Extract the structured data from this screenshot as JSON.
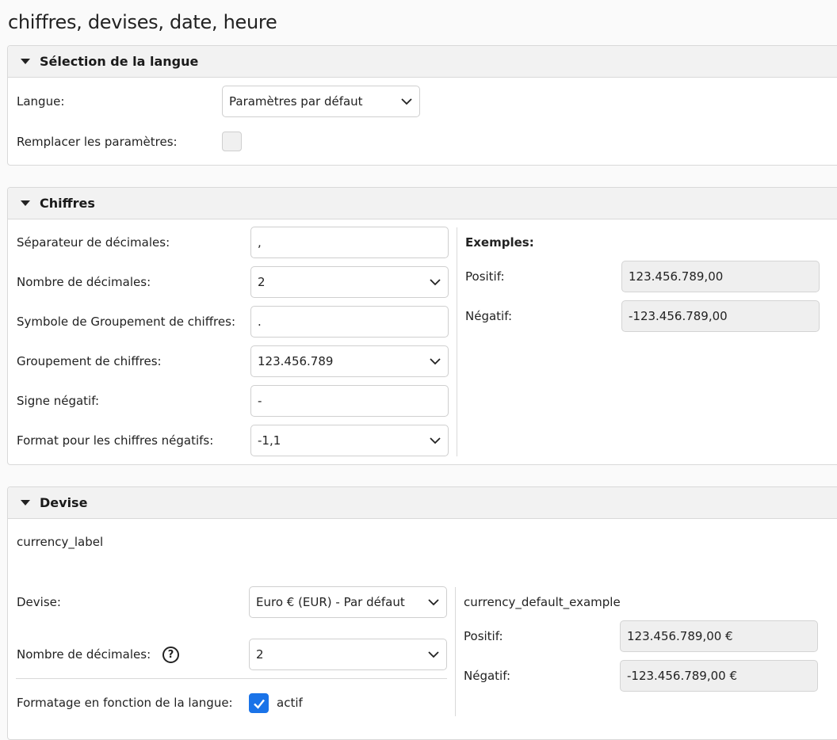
{
  "page": {
    "title": "chiffres, devises, date, heure"
  },
  "language_section": {
    "title": "Sélection de la langue",
    "language_label": "Langue:",
    "language_value": "Paramètres par défaut",
    "override_label": "Remplacer les paramètres:",
    "override_checked": false
  },
  "numbers_section": {
    "title": "Chiffres",
    "decimal_separator_label": "Séparateur de décimales:",
    "decimal_separator_value": ",",
    "decimals_label": "Nombre de décimales:",
    "decimals_value": "2",
    "grouping_symbol_label": "Symbole de Groupement de chiffres:",
    "grouping_symbol_value": ".",
    "grouping_label": "Groupement de chiffres:",
    "grouping_value": "123.456.789",
    "negative_sign_label": "Signe négatif:",
    "negative_sign_value": "-",
    "negative_format_label": "Format pour les chiffres négatifs:",
    "negative_format_value": "-1,1",
    "examples_title": "Exemples:",
    "positive_label": "Positif:",
    "positive_value": "123.456.789,00",
    "negative_label": "Négatif:",
    "negative_value": "-123.456.789,00"
  },
  "currency_section": {
    "title": "Devise",
    "currency_label_text": "currency_label",
    "currency_field_label": "Devise:",
    "currency_value": "Euro € (EUR) - Par défaut",
    "decimals_label": "Nombre de décimales:",
    "decimals_value": "2",
    "help_icon_glyph": "?",
    "lang_format_label": "Formatage en fonction de la langue:",
    "lang_format_checked": true,
    "lang_format_value": "actif",
    "default_example_title": "currency_default_example",
    "positive_label": "Positif:",
    "positive_value": "123.456.789,00 €",
    "negative_label": "Négatif:",
    "negative_value": "-123.456.789,00 €"
  },
  "colors": {
    "accent": "#1a73e8",
    "panel_header": "#f2f2f2",
    "border": "#d9d9d9",
    "readonly_bg": "#efefef"
  },
  "icons": {
    "caret": "caret-down-icon",
    "chevron": "chevron-down-icon",
    "help": "question-circle-icon",
    "check": "check-icon"
  }
}
